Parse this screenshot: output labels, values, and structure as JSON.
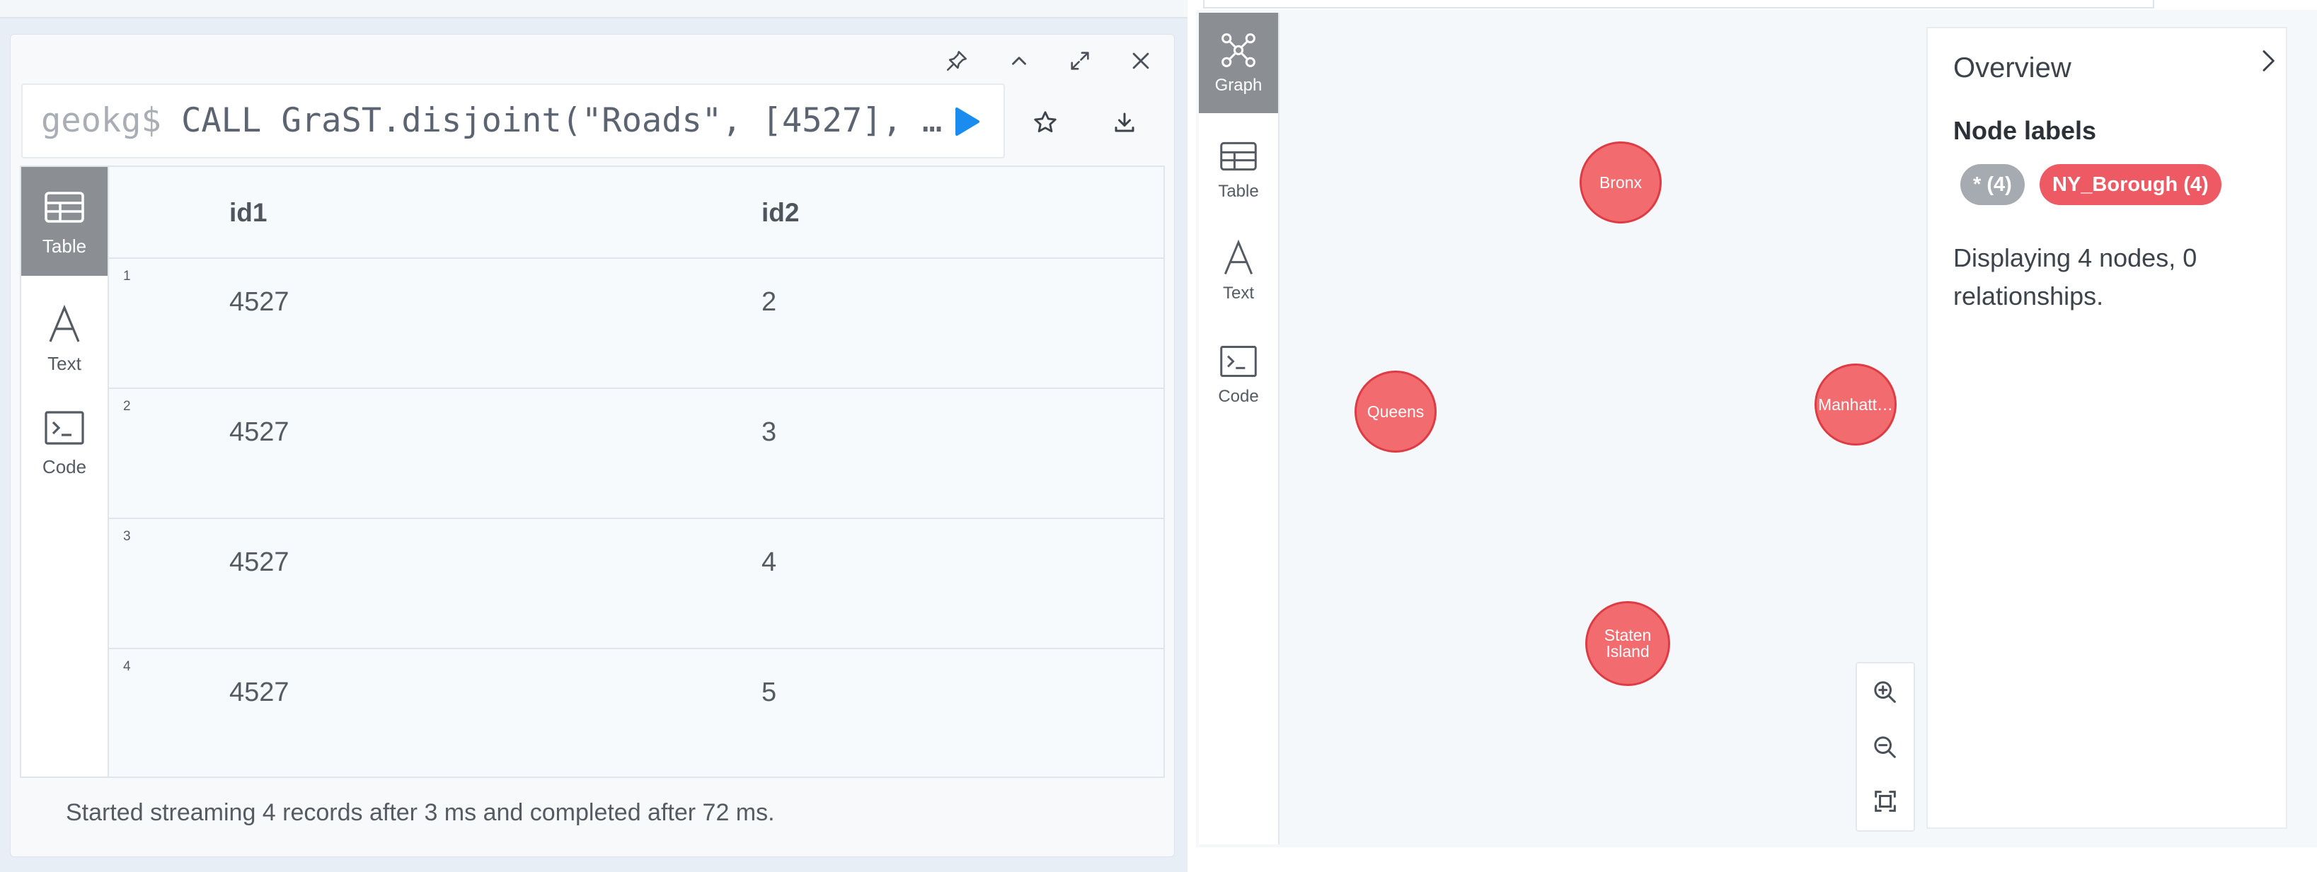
{
  "left_frame": {
    "editor": {
      "prompt": "geokg$",
      "command": "CALL GraST.disjoint(\"Roads\", [4527], …"
    },
    "result_view_tabs": [
      {
        "label": "Table",
        "icon": "table-icon",
        "active": true
      },
      {
        "label": "Text",
        "icon": "text-icon",
        "active": false
      },
      {
        "label": "Code",
        "icon": "code-icon",
        "active": false
      }
    ],
    "table": {
      "columns": [
        "id1",
        "id2"
      ],
      "rows": [
        {
          "num": "1",
          "id1": "4527",
          "id2": "2"
        },
        {
          "num": "2",
          "id1": "4527",
          "id2": "3"
        },
        {
          "num": "3",
          "id1": "4527",
          "id2": "4"
        },
        {
          "num": "4",
          "id1": "4527",
          "id2": "5"
        }
      ]
    },
    "status": "Started streaming 4 records after 3 ms and completed after 72 ms."
  },
  "right_frame": {
    "view_tabs": [
      {
        "label": "Graph",
        "icon": "graph-icon",
        "active": true
      },
      {
        "label": "Table",
        "icon": "table-icon",
        "active": false
      },
      {
        "label": "Text",
        "icon": "text-icon",
        "active": false
      },
      {
        "label": "Code",
        "icon": "code-icon",
        "active": false
      }
    ],
    "nodes": [
      {
        "label": "Bronx"
      },
      {
        "label": "Queens"
      },
      {
        "label": "Manhatt…"
      },
      {
        "label": "Staten Island"
      }
    ],
    "overview": {
      "title": "Overview",
      "node_labels_heading": "Node labels",
      "pills": [
        {
          "text": "* (4)",
          "color": "#a6abb2"
        },
        {
          "text": "NY_Borough (4)",
          "color": "#ee5a63"
        }
      ],
      "description": "Displaying 4 nodes, 0 relationships."
    }
  },
  "colors": {
    "accent_blue": "#1a8cf0",
    "node_fill": "#f16b6f",
    "node_border": "#dd3c44",
    "active_tab": "#8b8e92"
  }
}
